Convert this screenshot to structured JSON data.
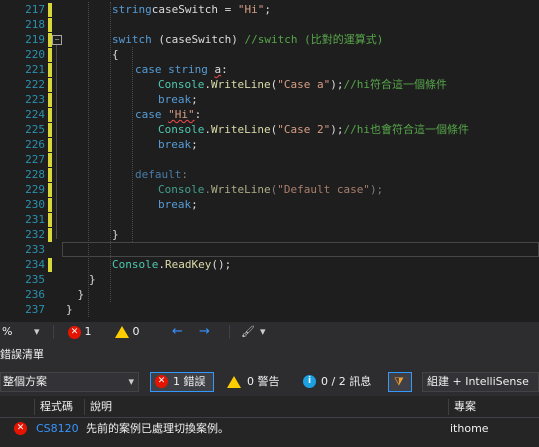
{
  "editor": {
    "lines": [
      {
        "num": "217",
        "mod": true,
        "indent": 2,
        "tokens": [
          [
            "kw",
            "string"
          ],
          [
            "",
            "caseSwitch = "
          ],
          [
            "str",
            "\"Hi\""
          ],
          [
            "",
            ";"
          ]
        ]
      },
      {
        "num": "218",
        "mod": true,
        "indent": 2,
        "tokens": []
      },
      {
        "num": "219",
        "mod": true,
        "indent": 2,
        "fold": true,
        "tokens": [
          [
            "kw",
            "switch"
          ],
          [
            "",
            " (caseSwitch) "
          ],
          [
            "cm",
            "//switch (比對的運算式)"
          ]
        ]
      },
      {
        "num": "220",
        "mod": true,
        "indent": 2,
        "tokens": [
          [
            "",
            "{"
          ]
        ]
      },
      {
        "num": "221",
        "mod": true,
        "indent": 3,
        "tokens": [
          [
            "kw",
            "case"
          ],
          [
            "",
            " "
          ],
          [
            "kw",
            "string"
          ],
          [
            "",
            " "
          ],
          [
            "sq",
            "a"
          ],
          [
            "",
            ":"
          ]
        ]
      },
      {
        "num": "222",
        "mod": true,
        "indent": 4,
        "tokens": [
          [
            "cls",
            "Console"
          ],
          [
            "",
            "."
          ],
          [
            "mth",
            "WriteLine"
          ],
          [
            "",
            "("
          ],
          [
            "str",
            "\"Case a\""
          ],
          [
            "",
            ");"
          ],
          [
            "cm",
            "//hi符合這一個條件"
          ]
        ]
      },
      {
        "num": "223",
        "mod": true,
        "indent": 4,
        "tokens": [
          [
            "kw",
            "break"
          ],
          [
            "",
            ";"
          ]
        ]
      },
      {
        "num": "224",
        "mod": true,
        "indent": 3,
        "tokens": [
          [
            "kw",
            "case"
          ],
          [
            "",
            " "
          ],
          [
            "sqs",
            "\"Hi\""
          ],
          [
            "",
            ":"
          ]
        ]
      },
      {
        "num": "225",
        "mod": true,
        "indent": 4,
        "tokens": [
          [
            "cls",
            "Console"
          ],
          [
            "",
            "."
          ],
          [
            "mth",
            "WriteLine"
          ],
          [
            "",
            "("
          ],
          [
            "str",
            "\"Case 2\""
          ],
          [
            "",
            ");"
          ],
          [
            "cm",
            "//hi也會符合這一個條件"
          ]
        ]
      },
      {
        "num": "226",
        "mod": true,
        "indent": 4,
        "tokens": [
          [
            "kw",
            "break"
          ],
          [
            "",
            ";"
          ]
        ]
      },
      {
        "num": "227",
        "mod": true,
        "indent": 3,
        "tokens": []
      },
      {
        "num": "228",
        "mod": true,
        "indent": 3,
        "tokens": [
          [
            "kwg",
            "default"
          ],
          [
            "g",
            ":"
          ]
        ]
      },
      {
        "num": "229",
        "mod": true,
        "indent": 4,
        "tokens": [
          [
            "clsg",
            "Console"
          ],
          [
            "g",
            "."
          ],
          [
            "mthg",
            "WriteLine"
          ],
          [
            "g",
            "("
          ],
          [
            "strg",
            "\"Default case\""
          ],
          [
            "g",
            ");"
          ]
        ]
      },
      {
        "num": "230",
        "mod": true,
        "indent": 4,
        "tokens": [
          [
            "kw",
            "break"
          ],
          [
            "",
            ";"
          ]
        ]
      },
      {
        "num": "231",
        "mod": true,
        "indent": 3,
        "tokens": []
      },
      {
        "num": "232",
        "mod": true,
        "indent": 2,
        "tokens": [
          [
            "",
            "}"
          ]
        ]
      },
      {
        "num": "233",
        "mod": false,
        "indent": 2,
        "tokens": [],
        "current": true
      },
      {
        "num": "234",
        "mod": true,
        "indent": 2,
        "tokens": [
          [
            "cls",
            "Console"
          ],
          [
            "",
            "."
          ],
          [
            "mth",
            "ReadKey"
          ],
          [
            "",
            "();"
          ]
        ]
      },
      {
        "num": "235",
        "mod": false,
        "indent": 1,
        "tokens": [
          [
            "",
            "}"
          ]
        ]
      },
      {
        "num": "236",
        "mod": false,
        "indent": 0.5,
        "tokens": [
          [
            "",
            "}"
          ]
        ]
      },
      {
        "num": "237",
        "mod": false,
        "indent": 0,
        "tokens": [
          [
            "",
            "}"
          ]
        ]
      }
    ]
  },
  "statusbar": {
    "zoom": "%",
    "error_count": "1",
    "warning_count": "0"
  },
  "error_list": {
    "title": "錯誤清單",
    "scope": "整個方案",
    "errors_btn": "1 錯誤",
    "warnings_btn": "0 警告",
    "messages_btn": "0 / 2 訊息",
    "build_filter": "組建 + IntelliSense",
    "columns": {
      "code": "程式碼",
      "description": "說明",
      "project": "專案"
    },
    "rows": [
      {
        "code": "CS8120",
        "description": "先前的案例已處理切換案例。",
        "project": "ithome"
      }
    ]
  },
  "colors": {
    "accent": "#3399ff",
    "error": "#e51400",
    "warning": "#ffcc00",
    "info": "#1ba1e2"
  }
}
